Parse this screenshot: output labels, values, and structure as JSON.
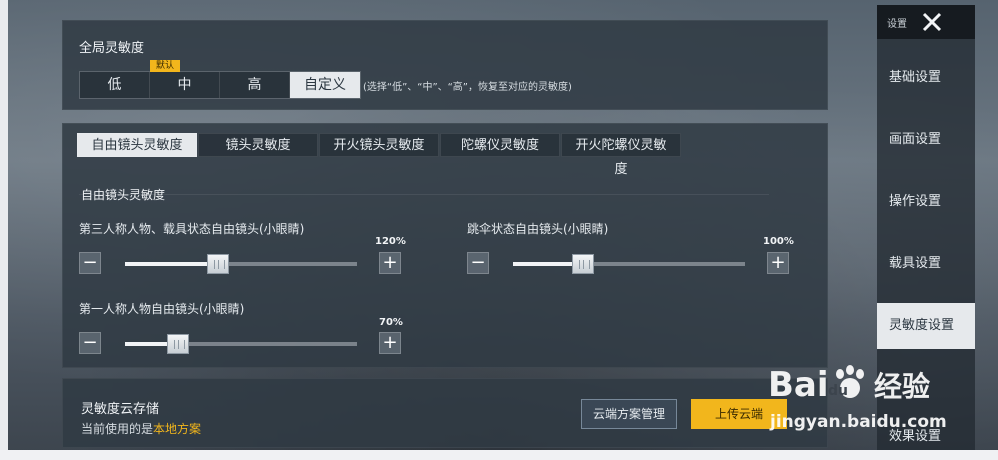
{
  "global": {
    "title": "全局灵敏度",
    "options": [
      "低",
      "中",
      "高",
      "自定义"
    ],
    "default_badge": "默认",
    "selected": "自定义",
    "hint": "(选择“低”、“中”、“高”，恢复至对应的灵敏度)"
  },
  "tabs": [
    "自由镜头灵敏度",
    "镜头灵敏度",
    "开火镜头灵敏度",
    "陀螺仪灵敏度",
    "开火陀螺仪灵敏度"
  ],
  "active_tab": "自由镜头灵敏度",
  "section": {
    "title": "自由镜头灵敏度"
  },
  "sliders": [
    {
      "label": "第三人称人物、载具状态自由镜头(小眼睛)",
      "value_text": "120%",
      "level": 0.4
    },
    {
      "label": "跳伞状态自由镜头(小眼睛)",
      "value_text": "100%",
      "level": 0.3
    },
    {
      "label": "第一人称人物自由镜头(小眼睛)",
      "value_text": "70%",
      "level": 0.23
    }
  ],
  "controls": {
    "minus": "−",
    "plus": "+"
  },
  "cloud": {
    "title": "灵敏度云存储",
    "current_prefix": "当前使用的是",
    "current_value": "本地方案",
    "manage_button": "云端方案管理",
    "upload_button": "上传云端"
  },
  "sidebar": {
    "header_label": "设置",
    "items": [
      "基础设置",
      "画面设置",
      "操作设置",
      "载具设置",
      "灵敏度设置",
      "效果设置"
    ],
    "active": "灵敏度设置"
  },
  "watermark": {
    "logo_text": "Baidu 经验",
    "url": "jingyan.baidu.com"
  },
  "colors": {
    "accent": "#f2b61c",
    "panel": "#303a44",
    "active_bg": "#e6e9ec"
  }
}
